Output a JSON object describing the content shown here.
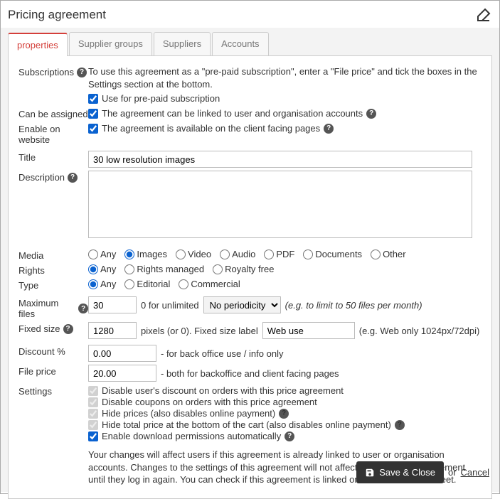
{
  "window": {
    "title": "Pricing agreement"
  },
  "tabs": {
    "t0": "properties",
    "t1": "Supplier groups",
    "t2": "Suppliers",
    "t3": "Accounts"
  },
  "labels": {
    "subscriptions": "Subscriptions",
    "canBeAssigned": "Can be assigned",
    "enableOnWebsite": "Enable on website",
    "title": "Title",
    "description": "Description",
    "media": "Media",
    "rights": "Rights",
    "type": "Type",
    "maxFiles": "Maximum files",
    "fixedSize": "Fixed size",
    "discount": "Discount %",
    "filePrice": "File price",
    "settings": "Settings"
  },
  "subscriptions": {
    "intro": "To use this agreement as a \"pre-paid subscription\", enter a \"File price\" and tick the boxes in the Settings section at the bottom.",
    "prepay": "Use for pre-paid subscription"
  },
  "assign": {
    "text": "The agreement can be linked to user and organisation accounts"
  },
  "enable": {
    "text": "The agreement is available on the client facing pages"
  },
  "fields": {
    "titleValue": "30 low resolution images",
    "descValue": "",
    "maxFiles": "30",
    "maxFilesHint": "0 for unlimited",
    "periodicity": "No periodicity",
    "periodHint": "(e.g. to limit to 50 files per month)",
    "fixedSize": "1280",
    "fixedSizeHint": "pixels (or 0). Fixed size label",
    "fixedSizeLabel": "Web use",
    "fixedSizeEg": "(e.g. Web only 1024px/72dpi)",
    "discount": "0.00",
    "discountHint": "- for back office use / info only",
    "filePrice": "20.00",
    "filePriceHint": "- both for backoffice and client facing pages"
  },
  "media": {
    "any": "Any",
    "images": "Images",
    "video": "Video",
    "audio": "Audio",
    "pdf": "PDF",
    "documents": "Documents",
    "other": "Other"
  },
  "rights": {
    "any": "Any",
    "rm": "Rights managed",
    "rf": "Royalty free"
  },
  "type": {
    "any": "Any",
    "editorial": "Editorial",
    "commercial": "Commercial"
  },
  "settings": {
    "s1": "Disable user's discount on orders with this price agreement",
    "s2": "Disable coupons on orders with this price agreement",
    "s3": "Hide prices (also disables online payment)",
    "s4": "Hide total price at the bottom of the cart (also disables online payment)",
    "s5": "Enable download permissions automatically"
  },
  "note": {
    "p1": "Your changes will affect users if this agreement is already linked to user or organisation accounts. Changes to the settings of this agreement will not affect users with this agreement until they log in again. You can check if this agreement is linked on the ",
    "em": "Accounts",
    "p2": " tabsheet."
  },
  "footer": {
    "save": "Save & Close",
    "or": "or",
    "cancel": "Cancel"
  }
}
